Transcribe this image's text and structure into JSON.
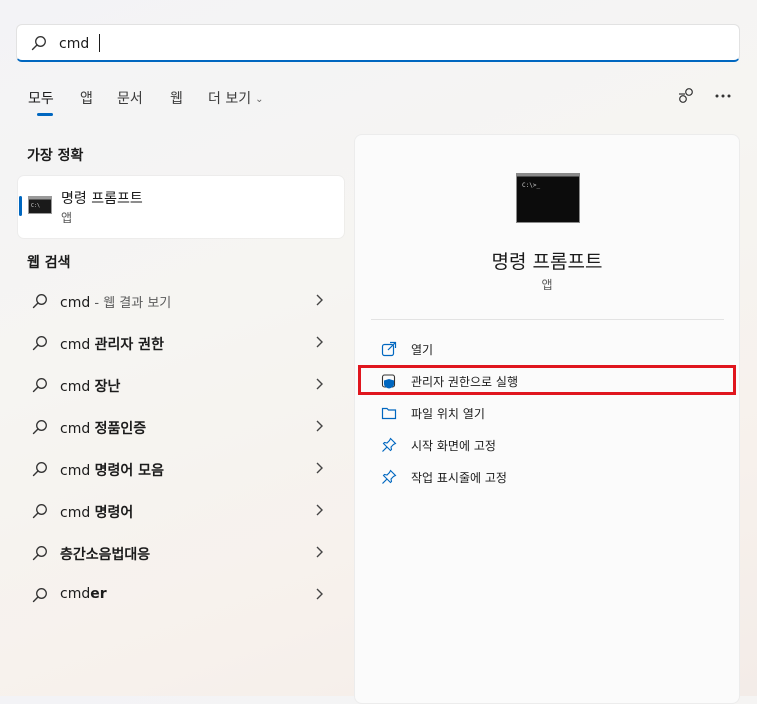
{
  "search": {
    "value": "cmd",
    "placeholder": ""
  },
  "tabs": [
    {
      "label": "모두",
      "active": true
    },
    {
      "label": "앱"
    },
    {
      "label": "문서"
    },
    {
      "label": "웹"
    },
    {
      "label": "더 보기"
    }
  ],
  "icons": {
    "search": "search-icon",
    "share": "share-icon",
    "more": "more-options-icon",
    "cmd": "command-prompt-icon"
  },
  "best_match": {
    "title": "가장 정확",
    "item": {
      "name": "명령 프롬프트",
      "type": "앱"
    }
  },
  "web_search": {
    "title": "웹 검색",
    "items": [
      {
        "prefix": "cmd",
        "bold": "",
        "suffix": " - 웹 결과 보기"
      },
      {
        "prefix": "cmd ",
        "bold": "관리자 권한",
        "suffix": ""
      },
      {
        "prefix": "cmd ",
        "bold": "장난",
        "suffix": ""
      },
      {
        "prefix": "cmd ",
        "bold": "정품인증",
        "suffix": ""
      },
      {
        "prefix": "cmd ",
        "bold": "명령어 모음",
        "suffix": ""
      },
      {
        "prefix": "cmd ",
        "bold": "명령어",
        "suffix": ""
      },
      {
        "prefix": "",
        "bold": "층간소음법대응",
        "suffix": ""
      },
      {
        "prefix": "cmd",
        "bold": "er",
        "suffix": ""
      }
    ]
  },
  "detail": {
    "name": "명령 프롬프트",
    "type": "앱",
    "actions": [
      {
        "label": "열기",
        "icon": "open-external-icon"
      },
      {
        "label": "관리자 권한으로 실행",
        "icon": "shield-icon"
      },
      {
        "label": "파일 위치 열기",
        "icon": "folder-icon"
      },
      {
        "label": "시작 화면에 고정",
        "icon": "pin-icon"
      },
      {
        "label": "작업 표시줄에 고정",
        "icon": "pin-icon"
      }
    ]
  },
  "colors": {
    "accent": "#0067c0",
    "highlight": "#e0161e"
  }
}
